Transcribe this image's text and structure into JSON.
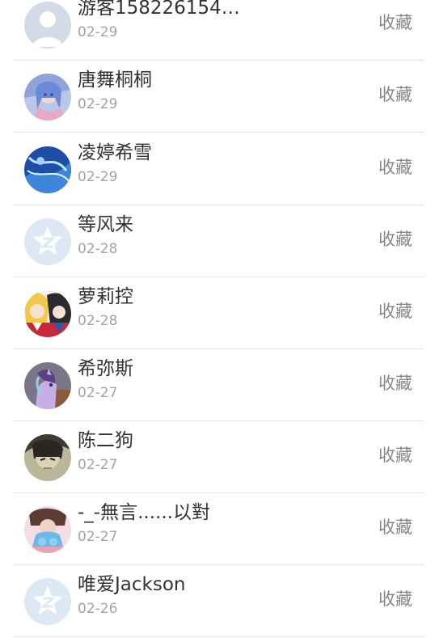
{
  "favorite_label": "收藏",
  "users": [
    {
      "name": "游客158226154…",
      "date": "02-29",
      "avatar": "default-person-avatar"
    },
    {
      "name": "唐舞桐桐",
      "date": "02-29",
      "avatar": "anime-girl-blue-hair-avatar"
    },
    {
      "name": "凌婷希雪",
      "date": "02-29",
      "avatar": "blue-anime-art-avatar"
    },
    {
      "name": "等风来",
      "date": "02-28",
      "avatar": "qzone-default-avatar"
    },
    {
      "name": "萝莉控",
      "date": "02-28",
      "avatar": "anime-duo-avatar"
    },
    {
      "name": "希弥斯",
      "date": "02-27",
      "avatar": "purple-pony-avatar"
    },
    {
      "name": "陈二狗",
      "date": "02-27",
      "avatar": "dark-hair-character-avatar"
    },
    {
      "name": "-_-無言......以對",
      "date": "02-27",
      "avatar": "pink-blue-photo-avatar"
    },
    {
      "name": "唯爱Jackson",
      "date": "02-26",
      "avatar": "qzone-default-avatar"
    }
  ]
}
